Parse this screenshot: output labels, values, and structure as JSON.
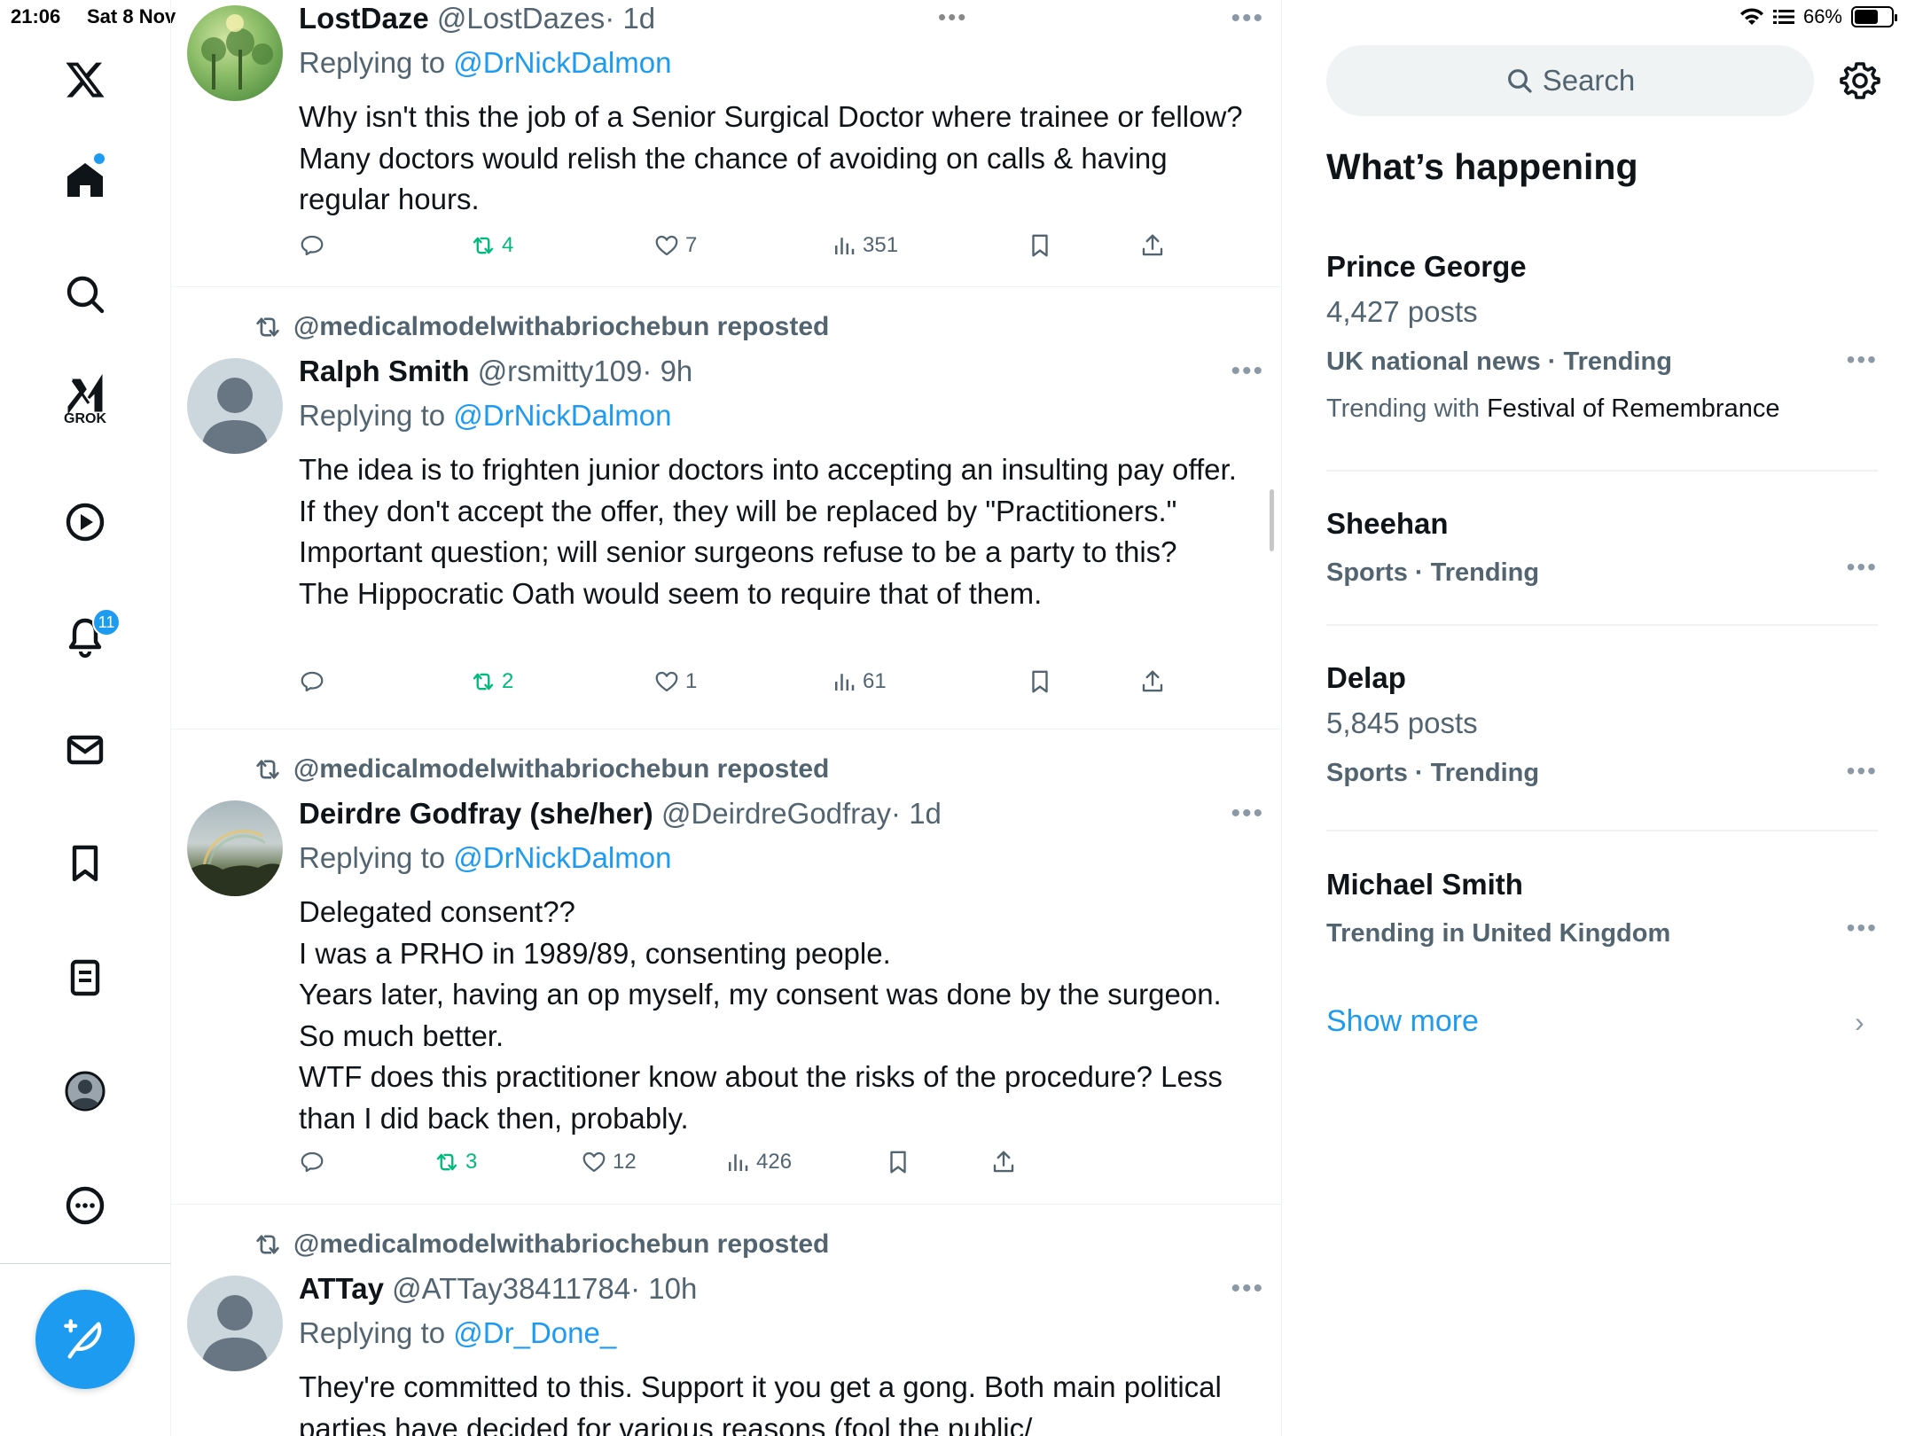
{
  "status_bar": {
    "time": "21:06",
    "date": "Sat 8 Nov",
    "battery": "66%",
    "battery_level": 0.66
  },
  "nav": {
    "grok_label": "GROK",
    "notifications_count": "11"
  },
  "feed": {
    "posts": [
      {
        "name": "LostDaze",
        "handle": "@LostDazes",
        "time": "· 1d",
        "replying_prefix": "Replying to ",
        "replying_to": "@DrNickDalmon",
        "text_lines": [
          "Why isn't this the job of a Senior Surgical Doctor where trainee or fellow? Many doctors would relish the chance of avoiding on calls & having regular hours."
        ],
        "replies": "",
        "reposts": "4",
        "likes": "7",
        "views": "351"
      },
      {
        "repost_by": "@medicalmodelwithabriochebun reposted",
        "name": "Ralph Smith",
        "handle": "@rsmitty109",
        "time": "· 9h",
        "replying_prefix": "Replying to ",
        "replying_to": "@DrNickDalmon",
        "text_lines": [
          "The idea is to frighten junior doctors into accepting an insulting pay offer.",
          "If they don't accept the offer, they will be replaced by \"Practitioners.\"",
          "Important question; will senior surgeons refuse to be a party to this?",
          "The Hippocratic Oath would seem to require that of them."
        ],
        "replies": "",
        "reposts": "2",
        "likes": "1",
        "views": "61"
      },
      {
        "repost_by": "@medicalmodelwithabriochebun reposted",
        "name": "Deirdre Godfray (she/her)",
        "handle": "@DeirdreGodfray",
        "time": "· 1d",
        "replying_prefix": "Replying to ",
        "replying_to": "@DrNickDalmon",
        "text_lines": [
          "Delegated consent??",
          "I was a PRHO in 1989/89, consenting people.",
          "Years later, having an op myself, my consent was done by the surgeon.",
          "So much better.",
          "WTF does this practitioner know about the risks of the procedure? Less than I did back then, probably."
        ],
        "replies": "",
        "reposts": "3",
        "likes": "12",
        "views": "426"
      },
      {
        "repost_by": "@medicalmodelwithabriochebun reposted",
        "name": "ATTay",
        "handle": "@ATTay38411784",
        "time": "· 10h",
        "replying_prefix": "Replying to ",
        "replying_to": "@Dr_Done_",
        "text_lines": [
          "They're committed to this.  Support it you get a gong. Both main political parties have decided for various reasons (fool the public/"
        ]
      }
    ]
  },
  "sidebar": {
    "search_placeholder": "Search",
    "whats_happening": "What’s happening",
    "trends": [
      {
        "name": "Prince George",
        "count": "4,427 posts",
        "meta": "UK national news · Trending",
        "with_prefix": "Trending with ",
        "with_topic": "Festival of Remembrance"
      },
      {
        "name": "Sheehan",
        "meta": "Sports · Trending"
      },
      {
        "name": "Delap",
        "count": "5,845 posts",
        "meta": "Sports · Trending"
      },
      {
        "name": "Michael Smith",
        "meta": "Trending in United Kingdom"
      }
    ],
    "show_more": "Show more"
  }
}
